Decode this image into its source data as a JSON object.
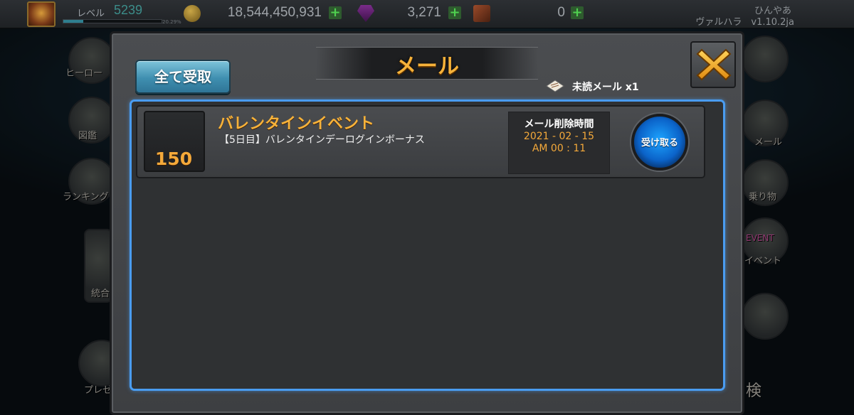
{
  "topbar": {
    "level_label": "レベル",
    "level_value": "5239",
    "xp_percent": "20.29%",
    "xp_fill": 0.2,
    "gold": "18,544,450,931",
    "gems": "3,271",
    "cubes": "0",
    "plus_label": "+",
    "user_name": "ひんやあ",
    "server_version": "ヴァルハラ　v1.10.2ja"
  },
  "side_menu": {
    "left": [
      {
        "icon": "hero-icon",
        "label": "ヒーロー"
      },
      {
        "icon": "book-icon",
        "label": "図鑑"
      },
      {
        "icon": "ranking-icon",
        "label": "ランキング"
      },
      {
        "icon": "merge-icon",
        "label": "統合"
      },
      {
        "icon": "present-icon",
        "label": "プレゼ"
      }
    ],
    "right": [
      {
        "icon": "gear-icon",
        "label": ""
      },
      {
        "icon": "mail-icon",
        "label": "メール"
      },
      {
        "icon": "mount-icon",
        "label": "乗り物"
      },
      {
        "icon": "event-icon",
        "label": "イベント",
        "badge": "EVENT"
      },
      {
        "icon": "sword-icon",
        "label": "検"
      }
    ]
  },
  "dialog": {
    "title": "メール",
    "claim_all_label": "全て受取",
    "unread_label": "未読メール x1",
    "colors": {
      "accent": "#f6b23a",
      "frame": "#4a9cf0",
      "button_blue": "#0b63c9"
    },
    "mails": [
      {
        "title": "バレンタインイベント",
        "description": "【5日目】バレンタインデーログインボーナス",
        "reward_count": "150",
        "delete_label": "メール削除時間",
        "delete_date": "2021 - 02 - 15",
        "delete_time": "AM 00 : 11",
        "receive_label": "受け取る"
      }
    ]
  }
}
